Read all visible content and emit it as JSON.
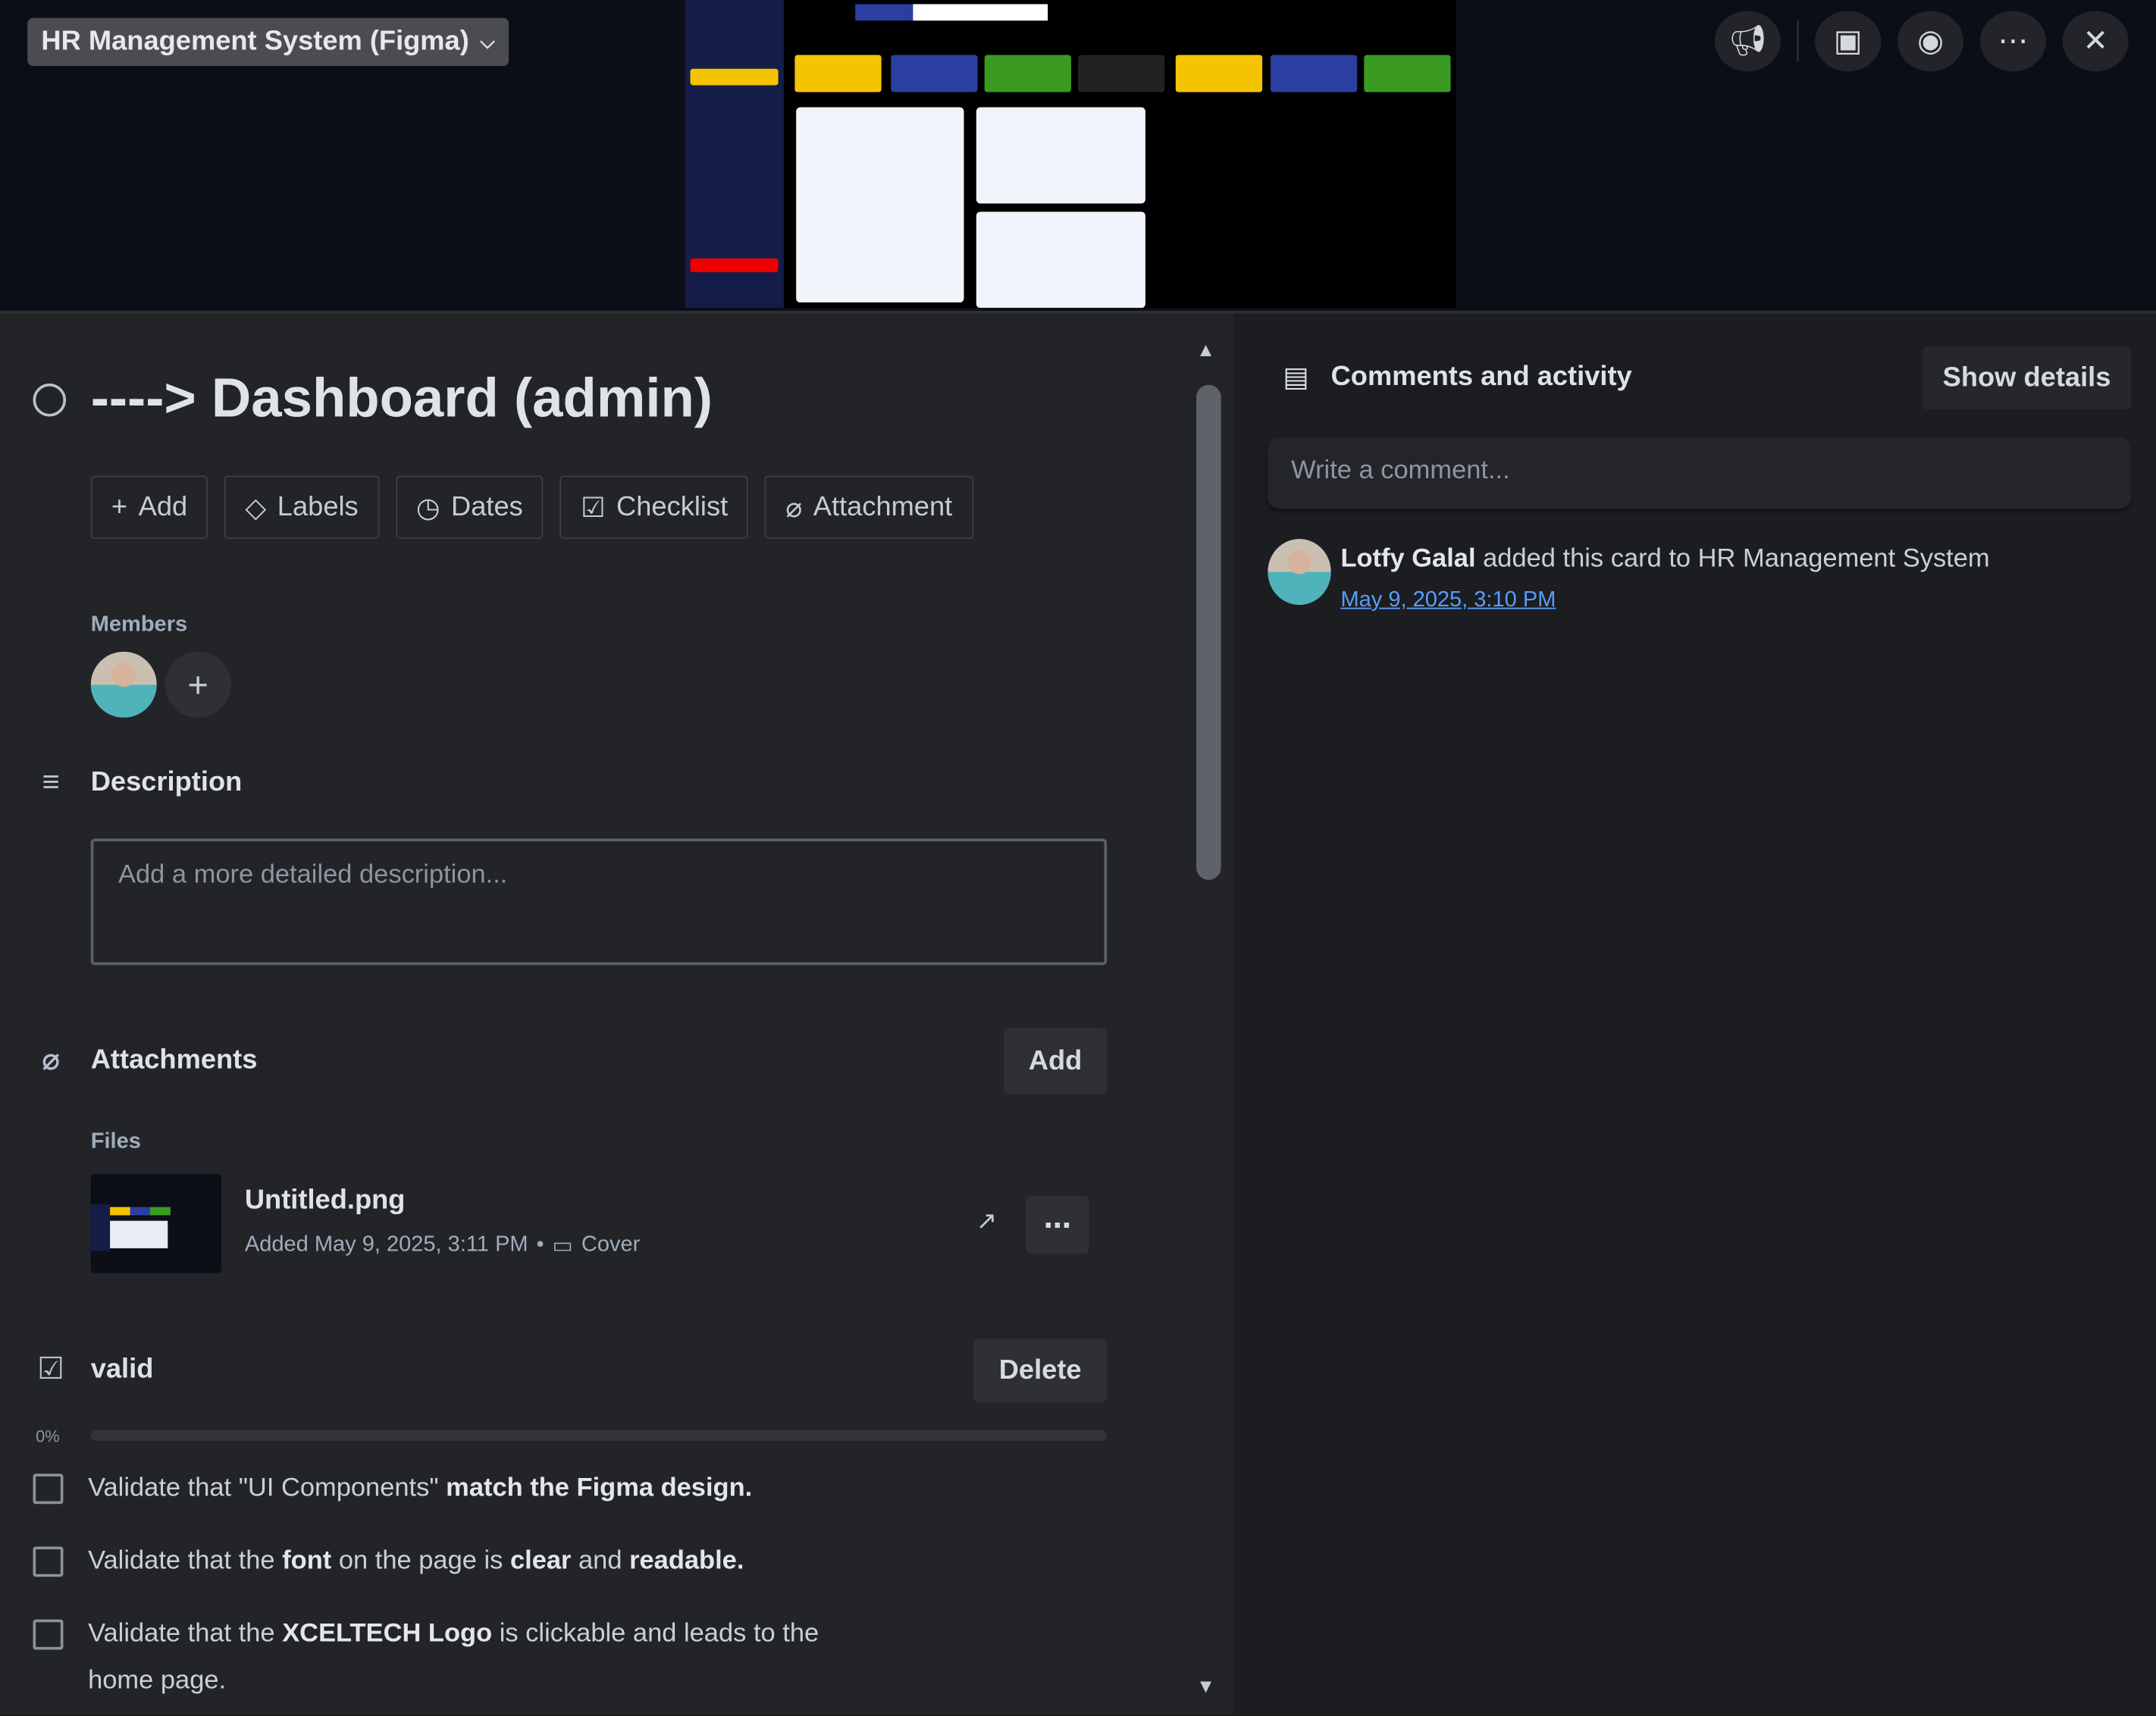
{
  "topbar": {
    "board_name": "HR Management System (Figma)",
    "icons": [
      "megaphone-icon",
      "image-icon",
      "eye-icon",
      "more-icon",
      "close-icon"
    ]
  },
  "card": {
    "title": "----> Dashboard (admin)",
    "actions": [
      {
        "icon": "+",
        "label": "Add"
      },
      {
        "icon": "◇",
        "label": "Labels"
      },
      {
        "icon": "◷",
        "label": "Dates"
      },
      {
        "icon": "☑",
        "label": "Checklist"
      },
      {
        "icon": "⌀",
        "label": "Attachment"
      }
    ],
    "members_label": "Members",
    "description": {
      "heading": "Description",
      "placeholder": "Add a more detailed description..."
    },
    "attachments": {
      "heading": "Attachments",
      "add_label": "Add",
      "files_label": "Files",
      "file": {
        "name": "Untitled.png",
        "added": "Added May 9, 2025, 3:11 PM",
        "separator": "•",
        "cover_label": "Cover"
      }
    },
    "checklist": {
      "title": "valid",
      "delete_label": "Delete",
      "progress_text": "0%",
      "progress": 0,
      "items": [
        {
          "segments": [
            {
              "t": "Validate that \"UI Components\" ",
              "b": false
            },
            {
              "t": "match the Figma design.",
              "b": true
            }
          ]
        },
        {
          "segments": [
            {
              "t": "Validate that the ",
              "b": false
            },
            {
              "t": "font",
              "b": true
            },
            {
              "t": " on the page is ",
              "b": false
            },
            {
              "t": "clear",
              "b": true
            },
            {
              "t": " and ",
              "b": false
            },
            {
              "t": "readable.",
              "b": true
            }
          ]
        },
        {
          "segments": [
            {
              "t": "Validate that the ",
              "b": false
            },
            {
              "t": "XCELTECH Logo",
              "b": true
            },
            {
              "t": " is clickable and leads to the home page.",
              "b": false
            }
          ]
        }
      ]
    }
  },
  "activity": {
    "heading": "Comments and activity",
    "show_details": "Show details",
    "comment_placeholder": "Write a comment...",
    "entries": [
      {
        "user": "Lotfy Galal",
        "action": " added this card to HR Management System",
        "time": "May 9, 2025, 3:10 PM"
      }
    ]
  },
  "colors": {
    "link": "#579dff",
    "cover_yellow": "#f5c400",
    "cover_blue": "#2a3fa0",
    "cover_green": "#3a9a22"
  }
}
